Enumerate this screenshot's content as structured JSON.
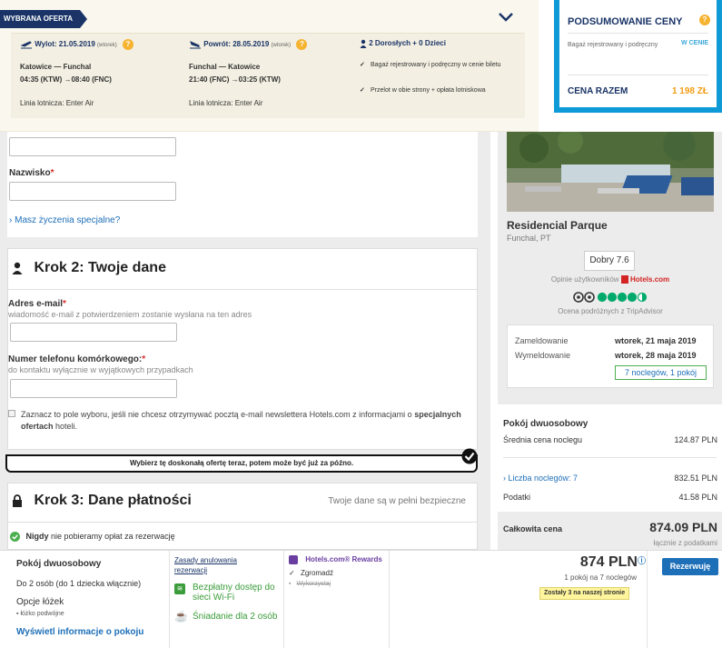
{
  "flight": {
    "badge": "WYBRANA OFERTA",
    "outbound": {
      "header_main": "Wylot: 21.05.2019",
      "header_day": "(wtorek)",
      "route": "Katowice — Funchal",
      "times": "04:35 (KTW) →08:40 (FNC)",
      "airline": "Linia lotnicza: Enter Air"
    },
    "return": {
      "header_main": "Powrót: 28.05.2019",
      "header_day": "(wtorek)",
      "route": "Funchal — Katowice",
      "times": "21:40 (FNC) →03:25 (KTW)",
      "airline": "Linia lotnicza: Enter Air"
    },
    "passengers": "2 Dorosłych + 0 Dzieci",
    "included": [
      "Bagaż rejestrowany i podręczny w cenie biletu",
      "Przelot w obie strony + opłata lotniskowa"
    ]
  },
  "summary": {
    "title": "PODSUMOWANIE CENY",
    "baggage_label": "Bagaż rejestrowany i podręczny",
    "baggage_value": "W CENIE",
    "total_label": "CENA RAZEM",
    "total_value": "1 198 ZŁ"
  },
  "form": {
    "surname_label": "Nazwisko",
    "special_requests_link": "Masz życzenia specjalne?",
    "step2_title": "Krok 2: Twoje dane",
    "email_label": "Adres e-mail",
    "email_hint": "wiadomość e-mail z potwierdzeniem zostanie wysłana na ten adres",
    "phone_label": "Numer telefonu komórkowego:",
    "phone_hint": "do kontaktu wyłącznie w wyjątkowych przypadkach",
    "newsletter_text": "Zaznacz to pole wyboru, jeśli nie chcesz otrzymywać pocztą e-mail newslettera Hotels.com z informacjami o",
    "newsletter_bold": "specjalnych ofertach",
    "newsletter_tail": "hoteli.",
    "banner": "Wybierz tę doskonałą ofertę teraz, potem może być już za późno.",
    "step3_title": "Krok 3: Dane płatności",
    "step3_secure": "Twoje dane są w pełni bezpieczne",
    "never_bold": "Nigdy",
    "never_rest": "nie pobieramy opłat za rezerwację"
  },
  "hotel": {
    "name": "Residencial Parque",
    "location": "Funchal, PT",
    "rating": "Dobry 7.6",
    "reviews_text": "Opinie użytkowników",
    "reviews_brand": "Hotels.com",
    "tripadvisor_text": "Ocena podróżnych z TripAdvisor",
    "checkin_label": "Zameldowanie",
    "checkin_value": "wtorek, 21 maja 2019",
    "checkout_label": "Wymeldowanie",
    "checkout_value": "wtorek, 28 maja 2019",
    "nights": "7 noclegów, 1 pokój",
    "room_type": "Pokój dwuosobowy",
    "avg_label": "Średnia cena noclegu",
    "avg_value": "124.87 PLN",
    "nights_link": "Liczba noclegów: 7",
    "nights_value": "832.51 PLN",
    "tax_label": "Podatki",
    "tax_value": "41.58 PLN",
    "total_label": "Całkowita cena",
    "total_value": "874.09 PLN",
    "total_note": "łącznie z podatkami"
  },
  "room": {
    "name": "Pokój dwuosobowy",
    "capacity": "Do 2 osób (do 1 dziecka włącznie)",
    "beds_title": "Opcje łóżek",
    "beds_item": "łóżko podwójne",
    "info_link": "Wyświetl informacje o pokoju",
    "cancel_link": "Zasady anulowania rezerwacji",
    "wifi": "Bezpłatny dostęp do sieci Wi-Fi",
    "breakfast": "Śniadanie dla 2 osób",
    "rewards_title": "Hotels.com® Rewards",
    "rewards_collect": "Zgromadź",
    "rewards_use": "Wykorzystaj",
    "price": "874 PLN",
    "price_note": "1 pokój na 7 noclegów",
    "left_badge": "Zostały 3 na naszej stronie",
    "book_button": "Rezerwuję"
  }
}
